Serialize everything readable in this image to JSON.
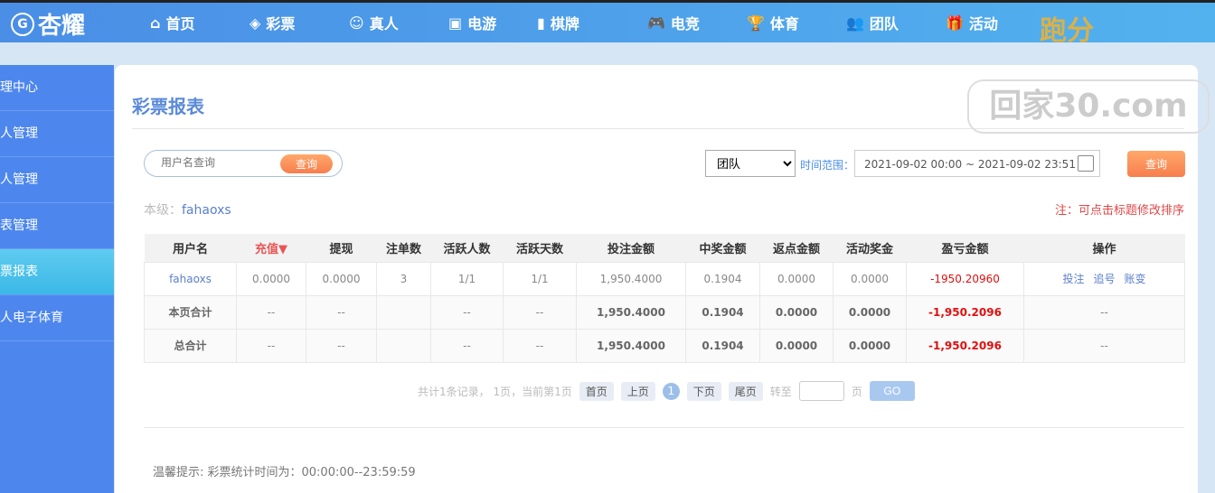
{
  "brand": {
    "logo": "杏耀",
    "logo_mark": "G",
    "promo": "跑分"
  },
  "nav": [
    {
      "label": "首页",
      "icon": "⌂",
      "name": "home"
    },
    {
      "label": "彩票",
      "icon": "◈",
      "name": "lottery"
    },
    {
      "label": "真人",
      "icon": "☺",
      "name": "live"
    },
    {
      "label": "电游",
      "icon": "▣",
      "name": "slots"
    },
    {
      "label": "棋牌",
      "icon": "▮",
      "name": "chess"
    },
    {
      "label": "电竞",
      "icon": "🎮",
      "name": "esports"
    },
    {
      "label": "体育",
      "icon": "🏆",
      "name": "sports"
    },
    {
      "label": "团队",
      "icon": "👥",
      "name": "team"
    },
    {
      "label": "活动",
      "icon": "🎁",
      "name": "events"
    }
  ],
  "sidebar": [
    "理中心",
    "人管理",
    "人管理",
    "表管理",
    "票报表",
    "人电子体育"
  ],
  "page": {
    "title": "彩票报表",
    "search_placeholder": "用户名查询",
    "search_btn": "查询",
    "select": "团队",
    "range_label": "时间范围：",
    "date_range": "2021-09-02 00:00 ~ 2021-09-02 23:51",
    "query_btn": "查询",
    "level_label": "本级：",
    "level_user": "fahaoxs",
    "note": "注：可点击标题修改排序"
  },
  "table": {
    "headers": [
      "用户名",
      "充值▼",
      "提现",
      "注单数",
      "活跃人数",
      "活跃天数",
      "投注金额",
      "中奖金额",
      "返点金额",
      "活动奖金",
      "盈亏金额",
      "操作"
    ],
    "row": [
      "fahaoxs",
      "0.0000",
      "0.0000",
      "3",
      "1/1",
      "1/1",
      "1,950.4000",
      "0.1904",
      "0.0000",
      "0.0000",
      "-1950.20960"
    ],
    "actions": [
      "投注",
      "追号",
      "账变"
    ],
    "page_total": [
      "本页合计",
      "--",
      "--",
      "",
      "--",
      "--",
      "1,950.4000",
      "0.1904",
      "0.0000",
      "0.0000",
      "-1,950.2096",
      "--"
    ],
    "grand_total": [
      "总合计",
      "--",
      "--",
      "",
      "--",
      "--",
      "1,950.4000",
      "0.1904",
      "0.0000",
      "0.0000",
      "-1,950.2096",
      "--"
    ]
  },
  "pager": {
    "info": "共计1条记录， 1页，当前第1页",
    "first": "首页",
    "prev": "上页",
    "current": "1",
    "next": "下页",
    "last": "尾页",
    "goto": "转至",
    "page": "页",
    "go": "GO"
  },
  "tip": "温馨提示: 彩票统计时间为：00:00:00--23:59:59",
  "watermark": "回家30.com"
}
